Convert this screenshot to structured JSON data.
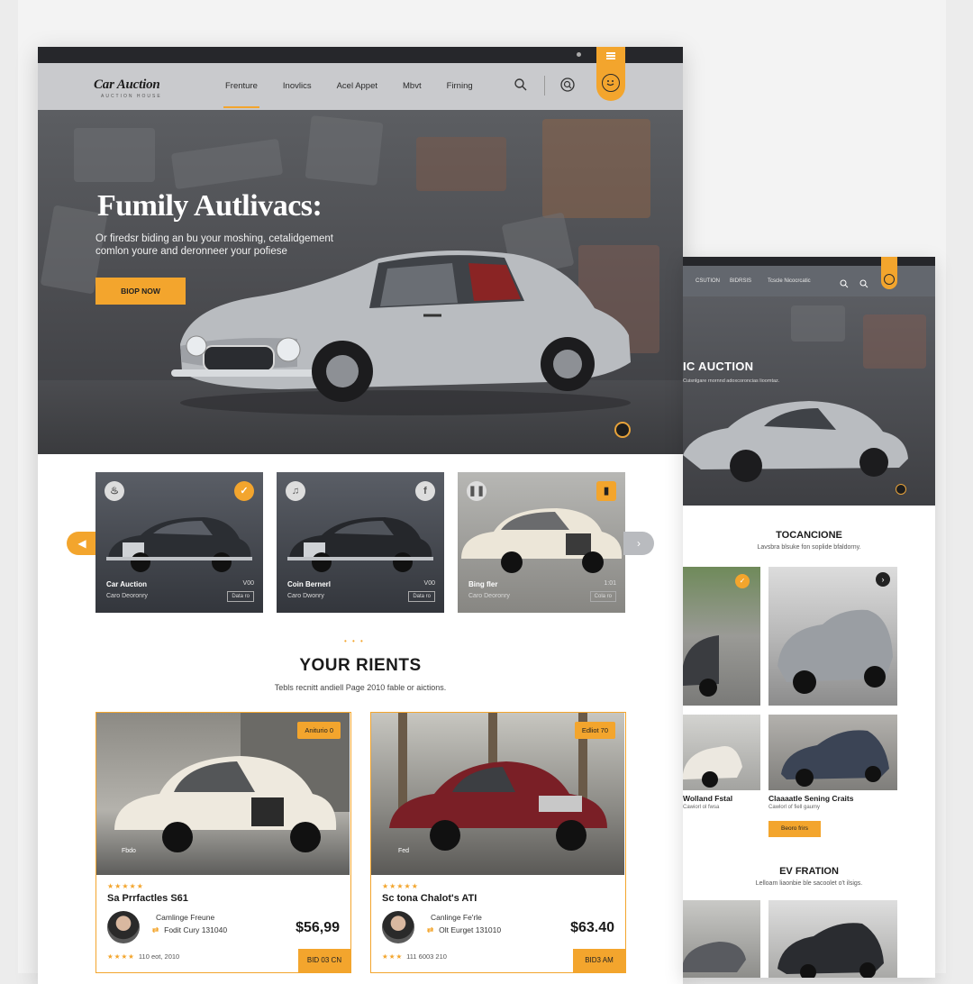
{
  "brand": {
    "name": "Car Auction",
    "tagline": "AUCTION HOUSE"
  },
  "nav": {
    "links": [
      "Frenture",
      "Inovlics",
      "Acel Appet",
      "Mbvt",
      "Firning"
    ],
    "active": 0
  },
  "hero": {
    "title": "Fumily Autlivacs:",
    "subtitle": "Or firedsr biding an bu your moshing, cetalidgement comlon youre and deronneer your pofiese",
    "cta": "BIOP NOW"
  },
  "thumbs": [
    {
      "title": "Car Auction",
      "sub": "Caro Deoronry",
      "value": "V00",
      "btn": "Data ro"
    },
    {
      "title": "Coin Bernerl",
      "sub": "Caro Dwonry",
      "value": "V00",
      "btn": "Data ro"
    },
    {
      "title": "Bing fler",
      "sub": "Caro Deoronry",
      "value": "1:01",
      "btn": "Cola ro"
    }
  ],
  "section": {
    "dots": "• • •",
    "title": "YOUR RIENTS",
    "subtitle": "Tebls recnitt andiell Page 2010 fable or aictions."
  },
  "cards": [
    {
      "tag": "Aniturio 0",
      "plate": "Fbdo",
      "stars": "★★★★★",
      "name": "Sa Prrfactles S61",
      "line1": "Camlinge Freune",
      "line2": "Fodit Cury 131040",
      "price": "$56,99",
      "foot_stars": "★★★★",
      "foot": "110 eot, 2010",
      "bid": "BID 03 CN"
    },
    {
      "tag": "Edliot 70",
      "plate": "Fed",
      "stars": "★★★★★",
      "name": "Sc tona Chalot's ATI",
      "line1": "Canlinge Fe'rle",
      "line2": "Olt Eurget 131010",
      "price": "$63.40",
      "foot_stars": "★★★",
      "foot": "111 6003 210",
      "bid": "BID3 AM"
    }
  ],
  "secondary": {
    "nav": [
      "CSUTION",
      "BIDRSIS",
      "Tcscle Nicocrcatic"
    ],
    "hero_title": "IC AUCTION",
    "hero_sub": "Cuisnlgare rnornnd adoxcoroncias lioomtaz.",
    "sec1_title": "TOCANCIONE",
    "sec1_sub": "Lavsbra blsuke fon soplide bfaldorny.",
    "cap1": "Wolland Fstal",
    "sub1": "Cawiorl ol fwsa",
    "cap2": "Claaaatle Sening Craits",
    "sub2": "Cawlorl of fiell gaumy",
    "btn2": "Beoro frirs",
    "sec2_title": "EV FRATION",
    "sec2_sub": "Lelloam liaonbie ble sacoolet o't ilsigs."
  },
  "colors": {
    "accent": "#f3a52d",
    "dark": "#26272b",
    "nav": "#c9cacd"
  },
  "icons": [
    "search-icon",
    "search-circle-icon",
    "menu-icon",
    "smiley-icon",
    "bell-icon",
    "twitter-icon",
    "music-icon",
    "facebook-icon",
    "pause-icon",
    "chevron-left-icon",
    "chevron-right-icon"
  ]
}
